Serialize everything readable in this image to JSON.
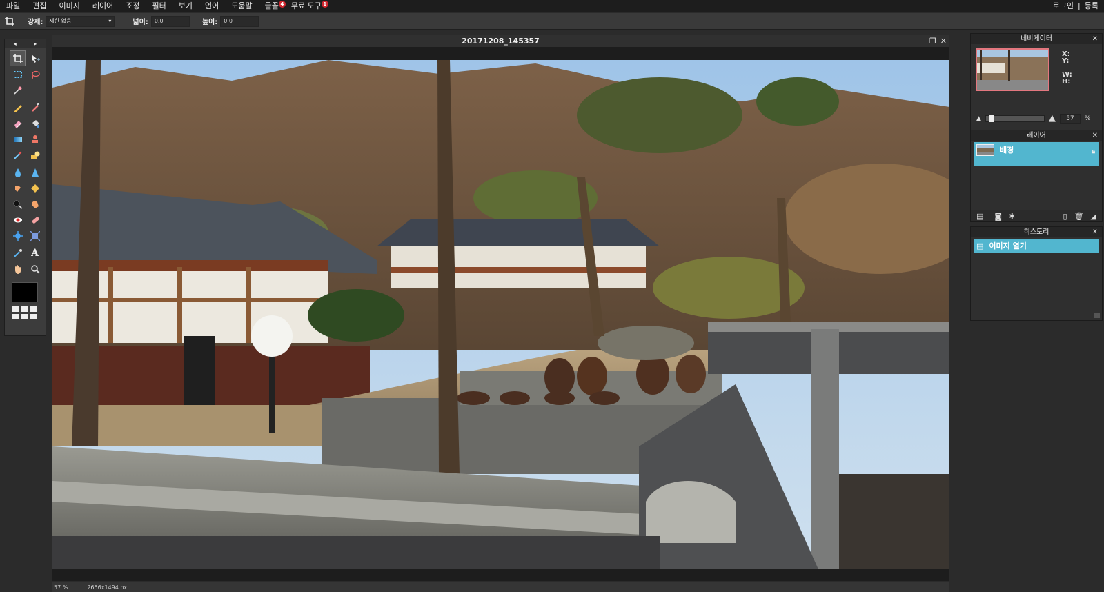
{
  "menubar": {
    "items": [
      {
        "label": "파일"
      },
      {
        "label": "편집"
      },
      {
        "label": "이미지"
      },
      {
        "label": "레이어"
      },
      {
        "label": "조정"
      },
      {
        "label": "필터"
      },
      {
        "label": "보기"
      },
      {
        "label": "언어"
      },
      {
        "label": "도움말"
      },
      {
        "label": "글꼴",
        "badge": "4"
      },
      {
        "label": "무료 도구",
        "badge": "1"
      }
    ],
    "login": "로그인",
    "separator": "|",
    "register": "등록"
  },
  "options": {
    "constrain_label": "강제:",
    "constrain_value": "제한 없음",
    "width_label": "넓이:",
    "width_value": "0.0",
    "height_label": "높이:",
    "height_value": "0.0"
  },
  "document": {
    "title": "20171208_145357",
    "zoom": "57",
    "zoom_unit": "%",
    "dimensions": "2656x1494 px"
  },
  "navigator": {
    "title": "네비게이터",
    "x_label": "X:",
    "y_label": "Y:",
    "w_label": "W:",
    "h_label": "H:",
    "zoom_value": "57",
    "zoom_unit": "%",
    "zoom_fraction": 0.06
  },
  "layers": {
    "title": "레이어",
    "items": [
      {
        "label": "배경"
      }
    ]
  },
  "history": {
    "title": "히스토리",
    "items": [
      {
        "label": "이미지 열기"
      }
    ]
  },
  "colors": {
    "selection": "#52b6cf",
    "badge": "#d0272f",
    "nav_frame": "#e3777f"
  }
}
